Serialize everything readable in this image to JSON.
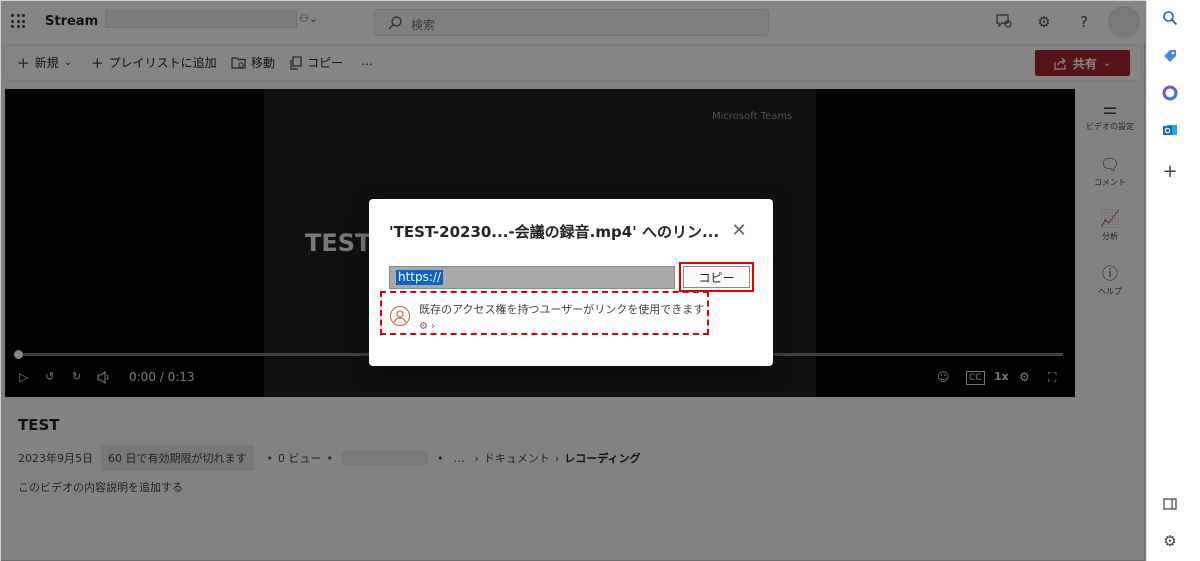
{
  "topbar": {
    "brand": "Stream",
    "search_placeholder": "検索"
  },
  "commands": {
    "new": "新規",
    "add_playlist": "プレイリストに追加",
    "move": "移動",
    "copy": "コピー",
    "more": "…",
    "share": "共有"
  },
  "player": {
    "watermark": "Microsoft Teams",
    "frame_title": "TEST",
    "time": "0:00 / 0:13",
    "speed": "1x",
    "progress": 0
  },
  "right_panel": [
    {
      "label": "ビデオの設定",
      "icon": "toggle-icon"
    },
    {
      "label": "コメント",
      "icon": "comment-icon"
    },
    {
      "label": "分析",
      "icon": "chart-icon"
    },
    {
      "label": "ヘルプ",
      "icon": "help-icon"
    }
  ],
  "video": {
    "title": "TEST",
    "date": "2023年9月5日",
    "expiry": "60 日で有効期限が切れます",
    "views": "0 ビュー",
    "bullet": "•",
    "ellipsis": "…",
    "crumb_documents": "ドキュメント",
    "crumb_recordings": "レコーディング",
    "description": "このビデオの内容説明を追加する"
  },
  "dialog": {
    "title": "'TEST-20230...-会議の録音.mp4' へのリン...",
    "link_text": "https://",
    "copy_label": "コピー",
    "access_text": "既存のアクセス権を持つユーザーがリンクを使用できます",
    "accent": "#e00000"
  },
  "colors": {
    "share_button": "#a4262c",
    "highlight": "#e00000",
    "selection": "#0a64c8"
  }
}
